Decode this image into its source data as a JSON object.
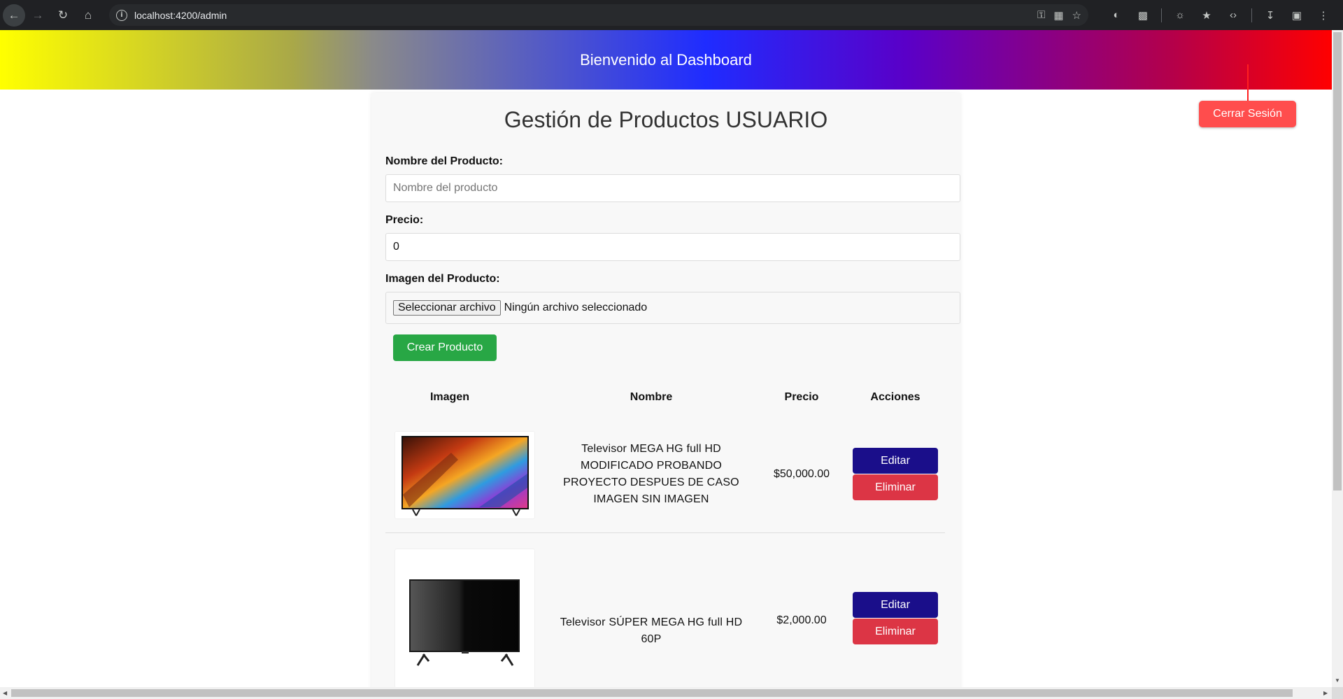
{
  "browser": {
    "url": "localhost:4200/admin"
  },
  "header": {
    "title": "Bienvenido al Dashboard",
    "logout_label": "Cerrar Sesión"
  },
  "form": {
    "page_title": "Gestión de Productos USUARIO",
    "name_label": "Nombre del Producto:",
    "name_placeholder": "Nombre del producto",
    "price_label": "Precio:",
    "price_value": "0",
    "image_label": "Imagen del Producto:",
    "file_button": "Seleccionar archivo",
    "file_status": "Ningún archivo seleccionado",
    "create_label": "Crear Producto"
  },
  "table": {
    "headers": [
      "Imagen",
      "Nombre",
      "Precio",
      "Acciones"
    ],
    "rows": [
      {
        "name": "Televisor MEGA HG full HD MODIFICADO PROBANDO PROYECTO DESPUES DE CASO IMAGEN SIN IMAGEN",
        "price": "$50,000.00",
        "edit_label": "Editar",
        "delete_label": "Eliminar"
      },
      {
        "name": "Televisor SÚPER MEGA HG full HD 60P",
        "price": "$2,000.00",
        "edit_label": "Editar",
        "delete_label": "Eliminar"
      }
    ]
  },
  "colors": {
    "create": "#28a745",
    "edit": "#1a0e8a",
    "delete": "#dc3545",
    "logout": "#ff4d4d"
  }
}
